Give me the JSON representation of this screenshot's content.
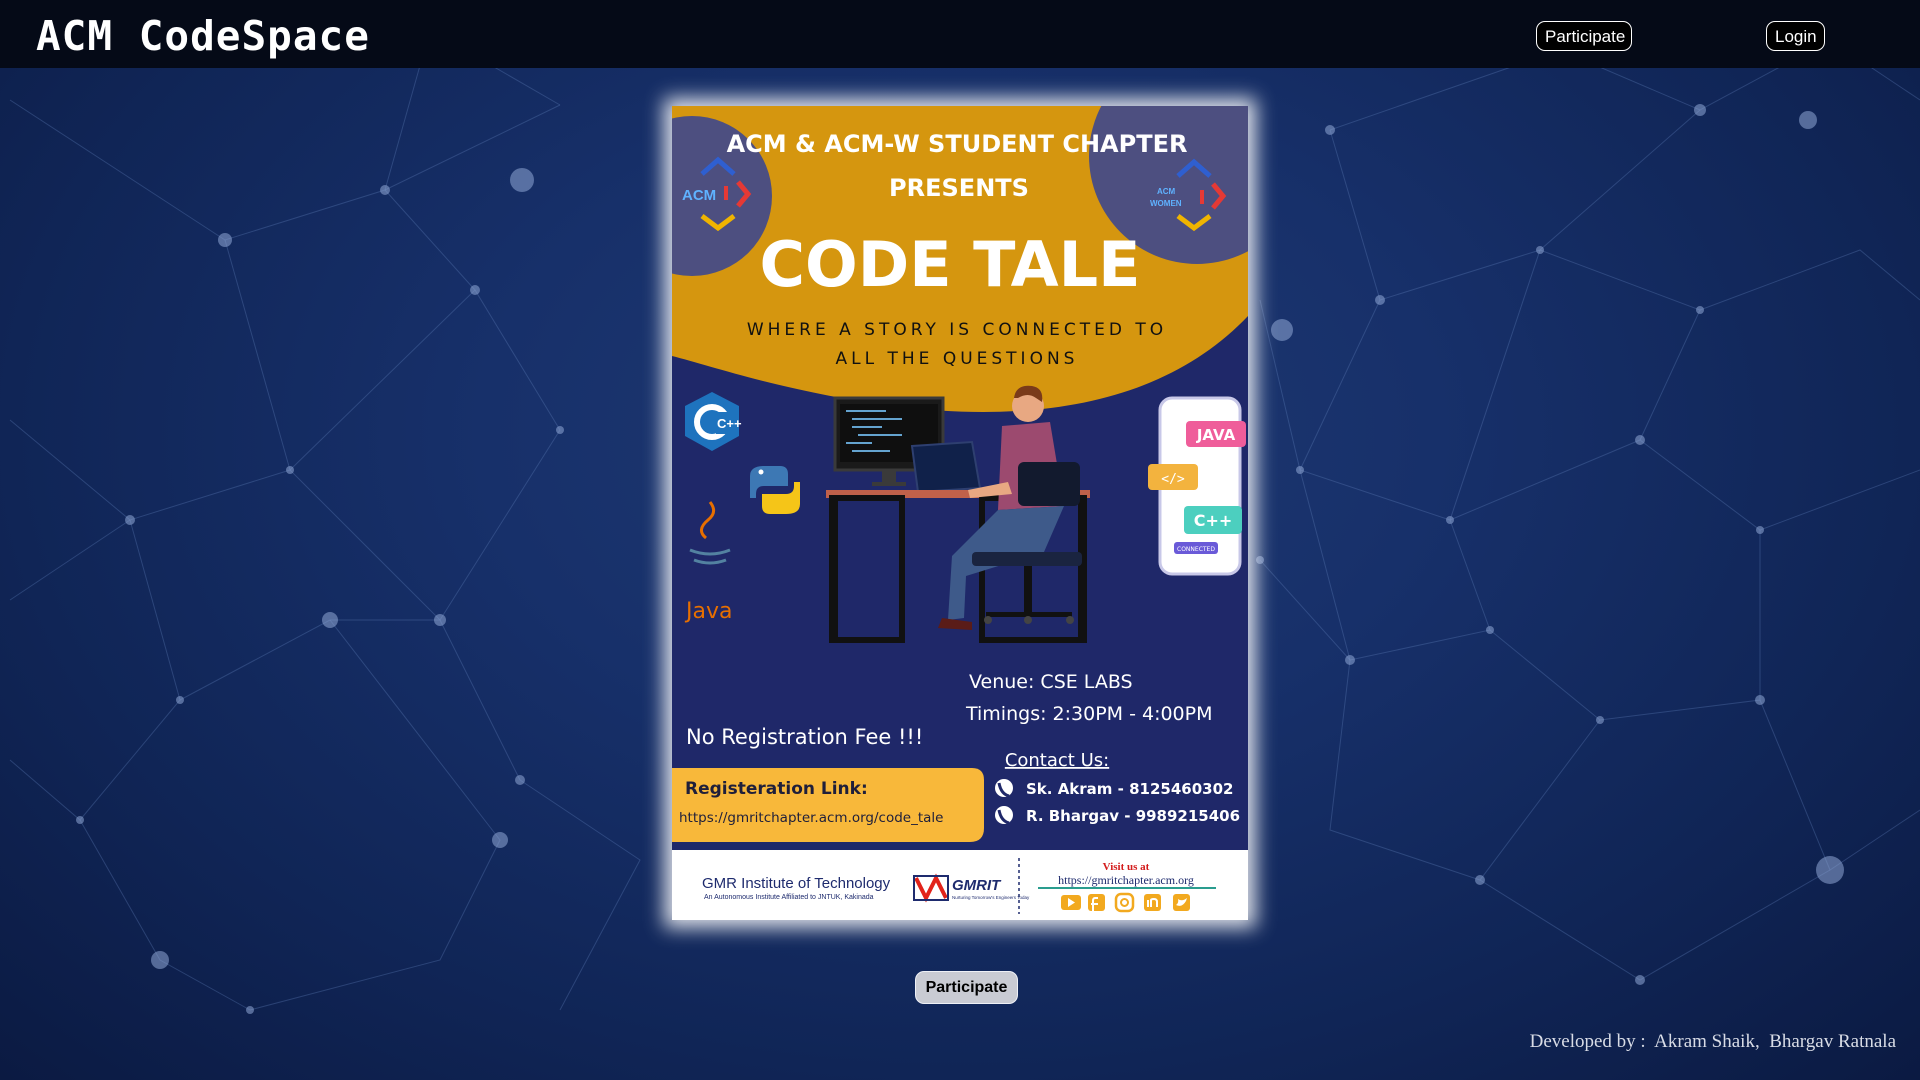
{
  "header": {
    "brand": "ACM CodeSpace",
    "participate_label": "Participate",
    "login_label": "Login"
  },
  "poster": {
    "chapter_line1": "ACM & ACM-W STUDENT CHAPTER",
    "chapter_line2": "PRESENTS",
    "acm_logo_text": "ACM",
    "acmw_logo_text_top": "ACM",
    "acmw_logo_text_bottom": "WOMEN",
    "event_title": "CODE TALE",
    "tagline_line1": "WHERE A STORY IS CONNECTED TO",
    "tagline_line2": "ALL THE QUESTIONS",
    "cpp_badge": "C++",
    "java_logo_text": "Java",
    "phone_tag_java": "JAVA",
    "phone_tag_code": "</>",
    "phone_tag_cpp": "C++",
    "phone_tag_connected": "CONNECTED",
    "venue": "Venue:  CSE LABS",
    "timings": "Timings:  2:30PM - 4:00PM",
    "fee": "No Registration Fee !!!",
    "contact_heading": "Contact Us:",
    "contact_1": "Sk. Akram  -  8125460302",
    "contact_2": "R. Bhargav - 9989215406",
    "reg_heading": "Registeration Link:",
    "reg_link": "https://gmritchapter.acm.org/code_tale",
    "institute_name": "GMR Institute of Technology",
    "institute_sub": "An Autonomous Institute Affiliated to JNTUK, Kakinada",
    "gmrit_logo": "GMRIT",
    "gmrit_tagline": "Nurturing Tomorrow's Engineers Today",
    "visit_label": "Visit us at",
    "visit_url": "https://gmritchapter.acm.org"
  },
  "main": {
    "participate_label": "Participate"
  },
  "footer": {
    "credit": "Developed by :  Akram Shaik,  Bhargav Ratnala"
  },
  "colors": {
    "navbar": "#050a17",
    "poster_navy": "#1f2869",
    "poster_gold": "#d5960f",
    "reg_box": "#f8b83a",
    "social_icon": "#f2a91f"
  }
}
